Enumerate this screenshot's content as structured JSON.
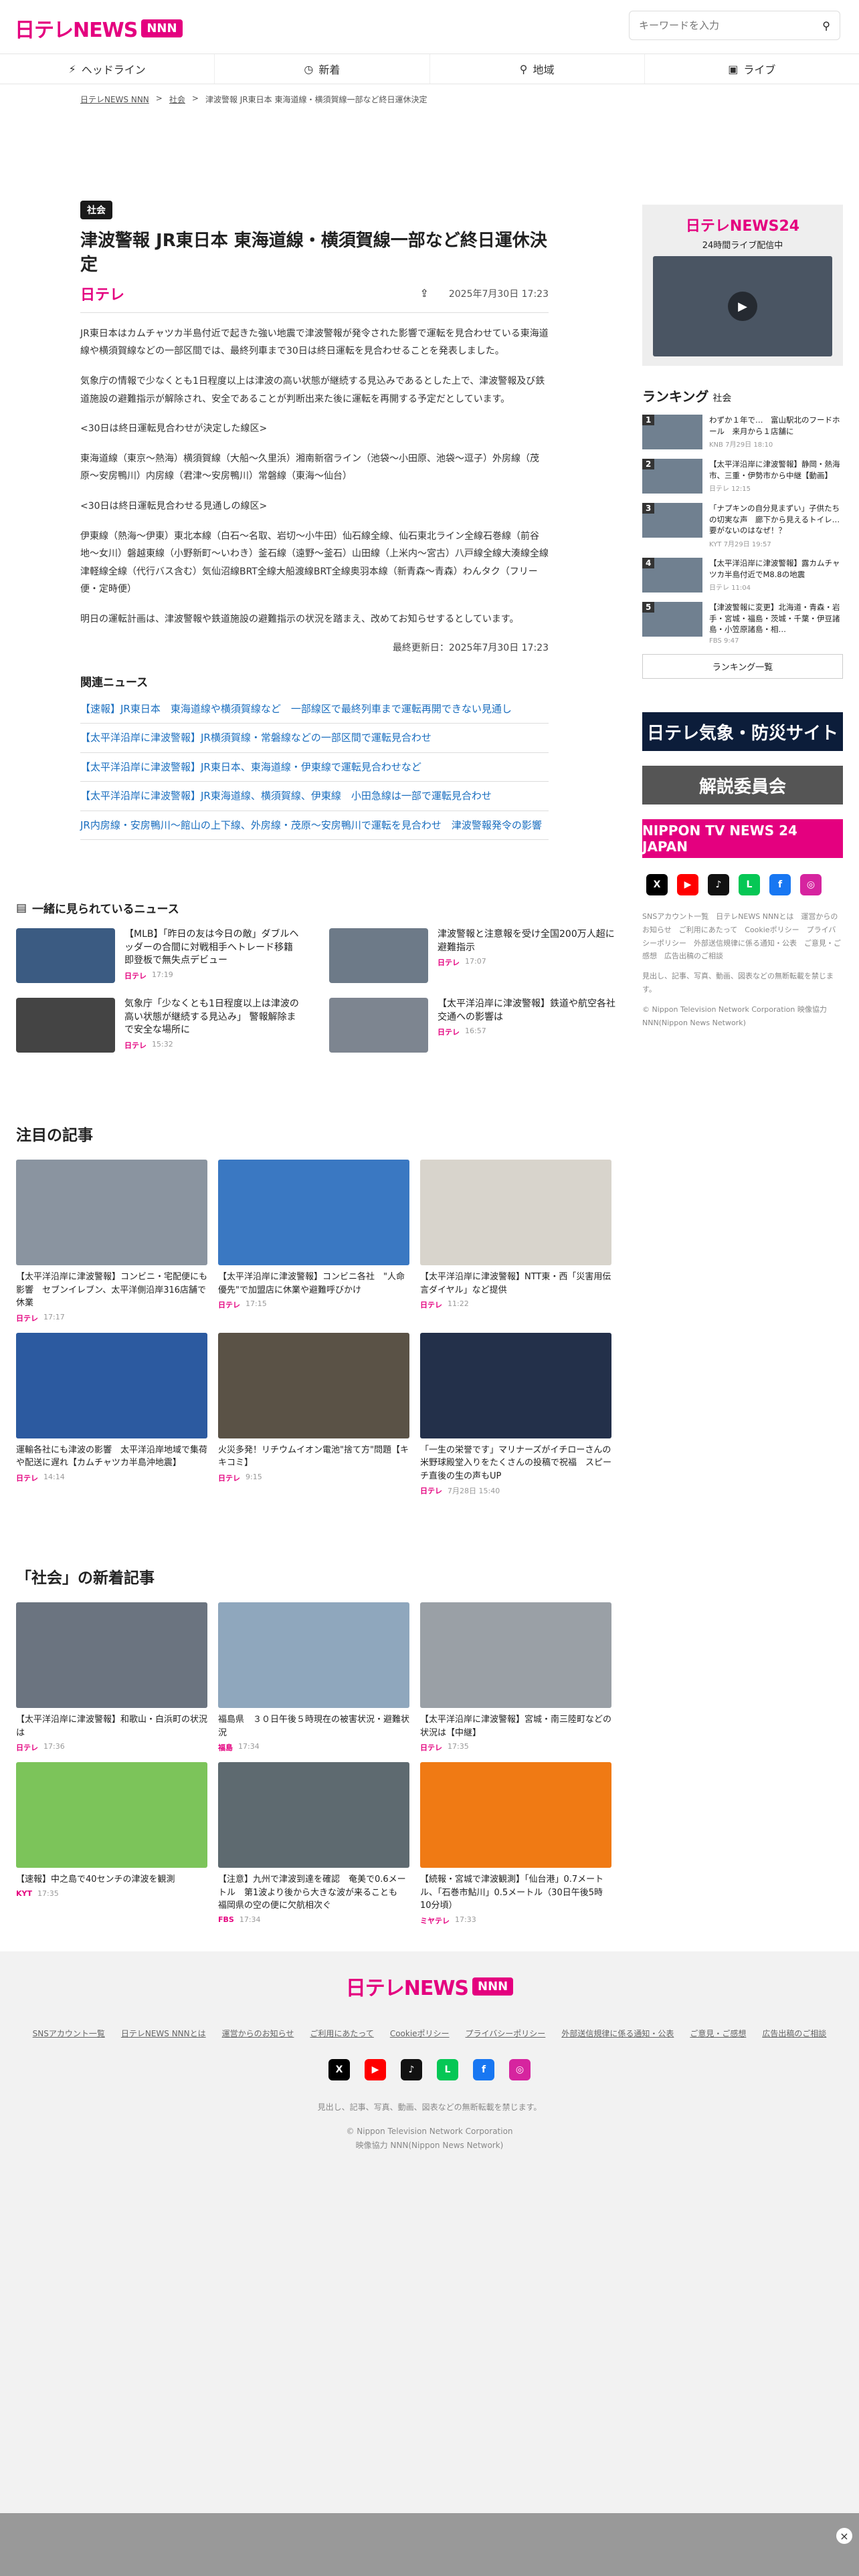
{
  "header": {
    "logo": "日テレNEWS",
    "logo_badge": "NNN",
    "search_placeholder": "キーワードを入力"
  },
  "nav": [
    "ヘッドライン",
    "新着",
    "地域",
    "ライブ"
  ],
  "breadcrumb": [
    "日テレNEWS NNN",
    "社会",
    "津波警報 JR東日本 東海道線・横須賀線一部など終日運休決定"
  ],
  "article": {
    "category": "社会",
    "title": "津波警報 JR東日本 東海道線・横須賀線一部など終日運休決定",
    "source": "日テレ",
    "date": "2025年7月30日 17:23",
    "paragraphs": [
      "JR東日本はカムチャツカ半島付近で起きた強い地震で津波警報が発令された影響で運転を見合わせている東海道線や横須賀線などの一部区間では、最終列車まで30日は終日運転を見合わせることを発表しました。",
      "気象庁の情報で少なくとも1日程度以上は津波の高い状態が継続する見込みであるとした上で、津波警報及び鉄道施設の避難指示が解除され、安全であることが判断出来た後に運転を再開する予定だとしています。",
      "<30日は終日運転見合わせが決定した線区>",
      "東海道線（東京〜熱海）横須賀線（大船〜久里浜）湘南新宿ライン（池袋〜小田原、池袋〜逗子）外房線（茂原〜安房鴨川）内房線（君津〜安房鴨川）常磐線（東海〜仙台）",
      "<30日は終日運転見合わせる見通しの線区>",
      "伊東線（熱海〜伊東）東北本線（白石〜名取、岩切〜小牛田）仙石線全線、仙石東北ライン全線石巻線（前谷地〜女川）磐越東線（小野新町〜いわき）釜石線（遠野〜釜石）山田線（上米内〜宮古）八戸線全線大湊線全線津軽線全線（代行バス含む）気仙沼線BRT全線大船渡線BRT全線奥羽本線（新青森〜青森）わんタク（フリー便・定時便）",
      "明日の運転計画は、津波警報や鉄道施設の避難指示の状況を踏まえ、改めてお知らせするとしています。"
    ],
    "updated": "最終更新日：2025年7月30日 17:23"
  },
  "related": {
    "heading": "関連ニュース",
    "items": [
      "【速報】JR東日本　東海道線や横須賀線など　一部線区で最終列車まで運転再開できない見通し",
      "【太平洋沿岸に津波警報】JR横須賀線・常磐線などの一部区間で運転見合わせ",
      "【太平洋沿岸に津波警報】JR東日本、東海道線・伊東線で運転見合わせなど",
      "【太平洋沿岸に津波警報】JR東海道線、横須賀線、伊東線　小田急線は一部で運転見合わせ",
      "JR内房線・安房鴨川〜館山の上下線、外房線・茂原〜安房鴨川で運転を見合わせ　津波警報発令の影響"
    ]
  },
  "together": {
    "heading": "一緒に見られているニュース",
    "items": [
      {
        "title": "【MLB】「昨日の友は今日の敵」ダブルヘッダーの合間に対戦相手へトレード移籍　即登板で無失点デビュー",
        "src": "日テレ",
        "time": "17:19"
      },
      {
        "title": "津波警報と注意報を受け全国200万人超に避難指示",
        "src": "日テレ",
        "time": "17:07"
      },
      {
        "title": "気象庁「少なくとも1日程度以上は津波の高い状態が継続する見込み」 警報解除まで安全な場所に",
        "src": "日テレ",
        "time": "15:32"
      },
      {
        "title": "【太平洋沿岸に津波警報】鉄道や航空各社　交通への影響は",
        "src": "日テレ",
        "time": "16:57"
      }
    ]
  },
  "featured": {
    "heading": "注目の記事",
    "items": [
      {
        "title": "【太平洋沿岸に津波警報】コンビニ・宅配便にも影響　セブンイレブン、太平洋側沿岸316店舗で休業",
        "src": "日テレ",
        "time": "17:17"
      },
      {
        "title": "【太平洋沿岸に津波警報】コンビニ各社　\"人命優先\"で加盟店に休業や避難呼びかけ",
        "src": "日テレ",
        "time": "17:15"
      },
      {
        "title": "【太平洋沿岸に津波警報】NTT東・西「災害用伝言ダイヤル」など提供",
        "src": "日テレ",
        "time": "11:22"
      },
      {
        "title": "運輸各社にも津波の影響　太平洋沿岸地域で集荷や配送に遅れ【カムチャツカ半島沖地震】",
        "src": "日テレ",
        "time": "14:14"
      },
      {
        "title": "火災多発！リチウムイオン電池\"捨て方\"問題【キキコミ】",
        "src": "日テレ",
        "time": "9:15"
      },
      {
        "title": "「一生の栄誉です」マリナーズがイチローさんの米野球殿堂入りをたくさんの投稿で祝福　スピーチ直後の生の声もUP",
        "src": "日テレ",
        "time": "7月28日 15:40"
      }
    ]
  },
  "newest": {
    "heading": "「社会」の新着記事",
    "items": [
      {
        "title": "【太平洋沿岸に津波警報】和歌山・白浜町の状況は",
        "src": "日テレ",
        "time": "17:36"
      },
      {
        "title": "福島県　３０日午後５時現在の被害状況・避難状況",
        "src": "福島",
        "time": "17:34"
      },
      {
        "title": "【太平洋沿岸に津波警報】宮城・南三陸町などの状況は【中継】",
        "src": "日テレ",
        "time": "17:35"
      },
      {
        "title": "【速報】中之島で40センチの津波を観測",
        "src": "KYT",
        "time": "17:35"
      },
      {
        "title": "【注意】九州で津波到達を確認　奄美で0.6メートル　第1波より後から大きな波が来ることも　福岡県の空の便に欠航相次ぐ",
        "src": "FBS",
        "time": "17:34"
      },
      {
        "title": "【続報・宮城で津波観測】「仙台港」0.7メートル、「石巻市鮎川」0.5メートル（30日午後5時10分頃）",
        "src": "ミヤテレ",
        "time": "17:33"
      }
    ]
  },
  "sidebar": {
    "live_title": "日テレNEWS24",
    "live_sub": "24時間ライブ配信中",
    "ranking_heading": "ランキング",
    "ranking_cat": "社会",
    "ranking": [
      {
        "n": "1",
        "title": "わずか１年で…　富山駅北のフードホール　来月から１店舗に",
        "src": "KNB",
        "time": "7月29日 18:10"
      },
      {
        "n": "2",
        "title": "【太平洋沿岸に津波警報】静岡・熱海市、三重・伊勢市から中継【動画】",
        "src": "日テレ",
        "time": "12:15"
      },
      {
        "n": "3",
        "title": "「ナプキンの自分見まずい」子供たちの切実な声　廊下から見えるトイレ…要がないのはなぜ！？",
        "src": "KYT",
        "time": "7月29日 19:57"
      },
      {
        "n": "4",
        "title": "【太平洋沿岸に津波警報】露カムチャツカ半島付近でM8.8の地震",
        "src": "日テレ",
        "time": "11:04"
      },
      {
        "n": "5",
        "title": "【津波警報に変更】北海道・青森・岩手・宮城・福島・茨城・千葉・伊豆諸島・小笠原諸島・相…",
        "src": "FBS",
        "time": "9:47"
      }
    ],
    "ranking_more": "ランキング一覧",
    "banners": [
      "日テレ気象・防災サイト",
      "解説委員会",
      "NIPPON TV NEWS 24 JAPAN"
    ],
    "links": "SNSアカウント一覧　日テレNEWS NNNとは　運営からのお知らせ　ご利用にあたって　Cookieポリシー　プライバシーポリシー　外部送信規律に係る通知・公表　ご意見・ご感想　広告出稿のご相談",
    "copy": "見出し、記事、写真、動画、図表などの無断転載を禁じます。",
    "copyright": "© Nippon Television Network Corporation 映像協力 NNN(Nippon News Network)"
  },
  "footer": {
    "links": [
      "SNSアカウント一覧",
      "日テレNEWS NNNとは",
      "運営からのお知らせ",
      "ご利用にあたって",
      "Cookieポリシー",
      "プライバシーポリシー",
      "外部送信規律に係る通知・公表",
      "ご意見・ご感想",
      "広告出稿のご相談"
    ],
    "note": "見出し、記事、写真、動画、図表などの無断転載を禁じます。",
    "copyright": "© Nippon Television Network Corporation",
    "copyright2": "映像協力 NNN(Nippon News Network)"
  }
}
